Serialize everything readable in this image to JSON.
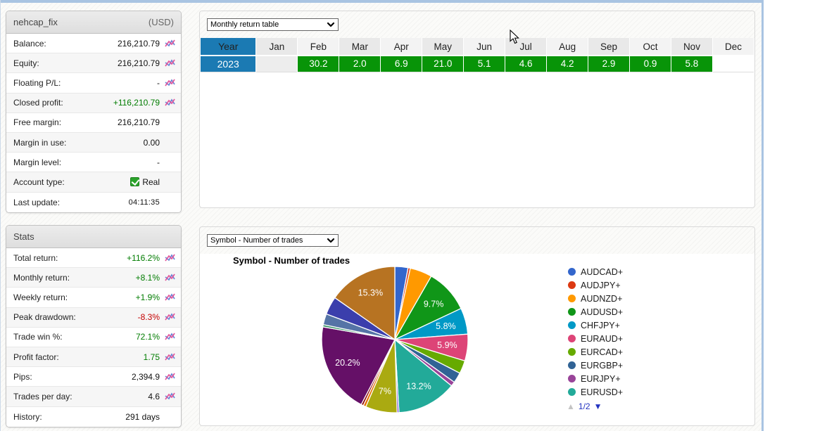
{
  "account": {
    "title": "nehcap_fix",
    "currency": "(USD)",
    "rows": [
      {
        "label": "Balance:",
        "value": "216,210.79",
        "color": "",
        "icon": true
      },
      {
        "label": "Equity:",
        "value": "216,210.79",
        "color": "",
        "icon": true
      },
      {
        "label": "Floating P/L:",
        "value": "-",
        "color": "",
        "icon": true
      },
      {
        "label": "Closed profit:",
        "value": "+116,210.79",
        "color": "green",
        "icon": true
      },
      {
        "label": "Free margin:",
        "value": "216,210.79",
        "color": "",
        "icon": false
      },
      {
        "label": "Margin in use:",
        "value": "0.00",
        "color": "",
        "icon": false
      },
      {
        "label": "Margin level:",
        "value": "-",
        "color": "",
        "icon": false
      },
      {
        "label": "Account type:",
        "value": "Real",
        "color": "",
        "icon": false,
        "checkbox": true
      },
      {
        "label": "Last update:",
        "value": "04:11:35",
        "color": "",
        "icon": false,
        "small": true
      }
    ]
  },
  "stats": {
    "title": "Stats",
    "rows": [
      {
        "label": "Total return:",
        "value": "+116.2%",
        "color": "green",
        "icon": true
      },
      {
        "label": "Monthly return:",
        "value": "+8.1%",
        "color": "green",
        "icon": true
      },
      {
        "label": "Weekly return:",
        "value": "+1.9%",
        "color": "green",
        "icon": true
      },
      {
        "label": "Peak drawdown:",
        "value": "-8.3%",
        "color": "red",
        "icon": true
      },
      {
        "label": "Trade win %:",
        "value": "72.1%",
        "color": "green",
        "icon": true
      },
      {
        "label": "Profit factor:",
        "value": "1.75",
        "color": "green",
        "icon": true
      },
      {
        "label": "Pips:",
        "value": "2,394.9",
        "color": "",
        "icon": true
      },
      {
        "label": "Trades per day:",
        "value": "4.6",
        "color": "",
        "icon": true
      },
      {
        "label": "History:",
        "value": "291 days",
        "color": "",
        "icon": false
      }
    ]
  },
  "monthly_panel": {
    "dropdown_value": "Monthly return table"
  },
  "symbol_panel": {
    "dropdown_value": "Symbol - Number of trades",
    "chart_title": "Symbol - Number of trades",
    "legend": [
      {
        "label": "AUDCAD+",
        "color": "#3366CC"
      },
      {
        "label": "AUDJPY+",
        "color": "#DC3912"
      },
      {
        "label": "AUDNZD+",
        "color": "#FF9900"
      },
      {
        "label": "AUDUSD+",
        "color": "#109618"
      },
      {
        "label": "CHFJPY+",
        "color": "#0099C6"
      },
      {
        "label": "EURAUD+",
        "color": "#DD4477"
      },
      {
        "label": "EURCAD+",
        "color": "#66AA00"
      },
      {
        "label": "EURGBP+",
        "color": "#316395"
      },
      {
        "label": "EURJPY+",
        "color": "#994499"
      },
      {
        "label": "EURUSD+",
        "color": "#22AA99"
      }
    ],
    "pager_label": "1/2"
  },
  "chart_data": [
    {
      "type": "table",
      "title": "Monthly return table",
      "columns": [
        "Year",
        "Jan",
        "Feb",
        "Mar",
        "Apr",
        "May",
        "Jun",
        "Jul",
        "Aug",
        "Sep",
        "Oct",
        "Nov",
        "Dec"
      ],
      "rows": [
        {
          "year": "2023",
          "values": [
            "",
            "30.2",
            "2.0",
            "6.9",
            "21.0",
            "5.1",
            "4.6",
            "4.2",
            "2.9",
            "0.9",
            "5.8",
            ""
          ]
        }
      ],
      "positive_color": "#089408",
      "year_color": "#1b7ab3"
    },
    {
      "type": "pie",
      "title": "Symbol - Number of trades",
      "legend_position": "right",
      "slices": [
        {
          "name": "AUDCAD+",
          "value": 2.9,
          "color": "#3366CC",
          "label": ""
        },
        {
          "name": "AUDJPY+",
          "value": 0.5,
          "color": "#DC3912",
          "label": ""
        },
        {
          "name": "AUDNZD+",
          "value": 4.9,
          "color": "#FF9900",
          "label": ""
        },
        {
          "name": "AUDUSD+",
          "value": 9.7,
          "color": "#109618",
          "label": "9.7%"
        },
        {
          "name": "CHFJPY+",
          "value": 5.8,
          "color": "#0099C6",
          "label": "5.8%"
        },
        {
          "name": "EURAUD+",
          "value": 5.9,
          "color": "#DD4477",
          "label": "5.9%"
        },
        {
          "name": "EURCAD+",
          "value": 2.9,
          "color": "#66AA00",
          "label": ""
        },
        {
          "name": "EURGBP+",
          "value": 2.3,
          "color": "#316395",
          "label": ""
        },
        {
          "name": "EURJPY+",
          "value": 1.0,
          "color": "#994499",
          "label": ""
        },
        {
          "name": "EURUSD+",
          "value": 13.2,
          "color": "#22AA99",
          "label": "13.2%"
        },
        {
          "name": "",
          "value": 0.4,
          "color": "#6633CC",
          "label": ""
        },
        {
          "name": "",
          "value": 7.0,
          "color": "#AAAA11",
          "label": "7%"
        },
        {
          "name": "",
          "value": 0.6,
          "color": "#E67300",
          "label": ""
        },
        {
          "name": "",
          "value": 0.5,
          "color": "#8B0707",
          "label": ""
        },
        {
          "name": "",
          "value": 20.2,
          "color": "#651067",
          "label": "20.2%"
        },
        {
          "name": "",
          "value": 0.5,
          "color": "#329262",
          "label": ""
        },
        {
          "name": "",
          "value": 2.4,
          "color": "#5574A6",
          "label": ""
        },
        {
          "name": "",
          "value": 4.0,
          "color": "#3B3EAC",
          "label": ""
        },
        {
          "name": "",
          "value": 15.3,
          "color": "#B77322",
          "label": "15.3%"
        }
      ]
    }
  ]
}
